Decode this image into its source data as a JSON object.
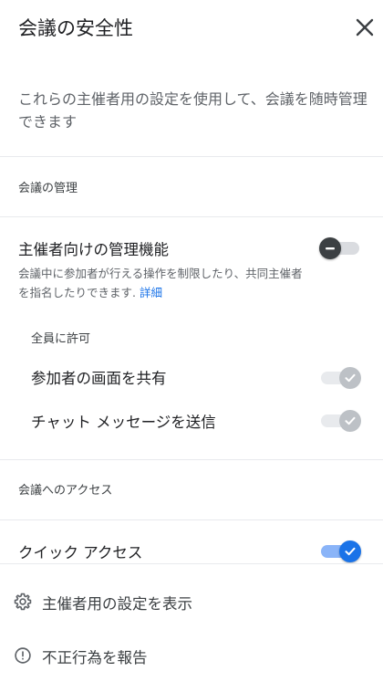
{
  "dialog": {
    "title": "会議の安全性",
    "description": "これらの主催者用の設定を使用して、会議を随時管理できます"
  },
  "host_management": {
    "section_label": "会議の管理",
    "title": "主催者向けの管理機能",
    "toggle_state": "off",
    "subtext": "会議中に参加者が行える操作を制限したり、共同主催者を指名したりできます.",
    "link_label": "詳細"
  },
  "allow_all": {
    "label": "全員に許可",
    "items": [
      {
        "label": "参加者の画面を共有",
        "toggle_state": "on-disabled"
      },
      {
        "label": "チャット メッセージを送信",
        "toggle_state": "on-disabled"
      }
    ]
  },
  "meeting_access": {
    "section_label": "会議へのアクセス",
    "quick_access": {
      "label": "クイック アクセス",
      "toggle_state": "on"
    }
  },
  "bottom_menu": {
    "items": [
      {
        "label": "主催者用の設定を表示",
        "icon": "gear-icon"
      },
      {
        "label": "不正行為を報告",
        "icon": "alert-circle-icon"
      }
    ]
  },
  "colors": {
    "accent": "#1a73e8",
    "toggle_on_track": "#8ab4f8",
    "toggle_off_thumb": "#3c4043",
    "disabled": "#bdc1c6"
  }
}
